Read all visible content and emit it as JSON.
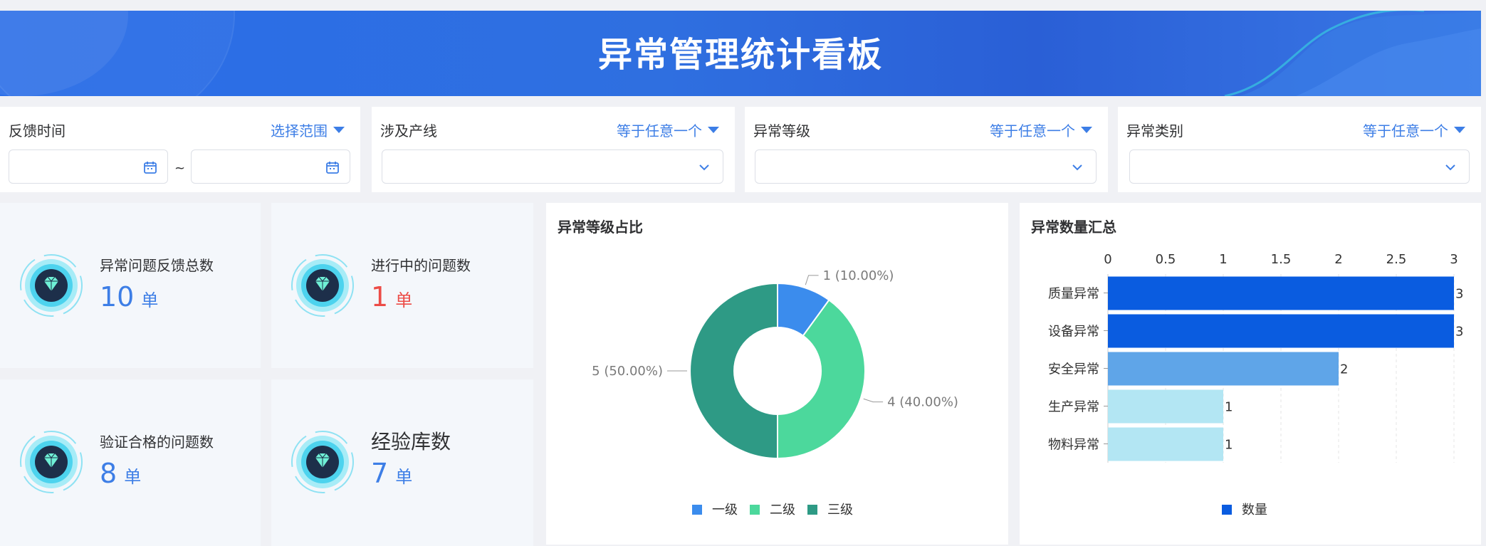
{
  "header": {
    "title": "异常管理统计看板"
  },
  "filters": [
    {
      "label": "反馈时间",
      "mode": "选择范围",
      "type": "date-range",
      "start_value": "",
      "end_value": "",
      "separator": "~"
    },
    {
      "label": "涉及产线",
      "mode": "等于任意一个",
      "type": "select",
      "value": ""
    },
    {
      "label": "异常等级",
      "mode": "等于任意一个",
      "type": "select",
      "value": ""
    },
    {
      "label": "异常类别",
      "mode": "等于任意一个",
      "type": "select",
      "value": ""
    }
  ],
  "stats": [
    {
      "label": "异常问题反馈总数",
      "value": "10",
      "unit": "单",
      "icon": "diamond-icon"
    },
    {
      "label": "进行中的问题数",
      "value": "1",
      "unit": "单",
      "icon": "diamond-icon",
      "value_color": "#ec4c47"
    },
    {
      "label": "验证合格的问题数",
      "value": "8",
      "unit": "单",
      "icon": "diamond-icon"
    },
    {
      "label": "经验库数",
      "value": "7",
      "unit": "单",
      "icon": "diamond-icon"
    }
  ],
  "colors": {
    "accent": "#3d7ee6",
    "red": "#ec4c47",
    "banner": "#2a6ee8"
  },
  "chart_data": [
    {
      "type": "pie",
      "title": "异常等级占比",
      "labels": [
        "一级",
        "二级",
        "三级"
      ],
      "values": [
        1,
        4,
        5
      ],
      "data_labels": [
        "1 (10.00%)",
        "4 (40.00%)",
        "5 (50.00%)"
      ],
      "colors": [
        "#3b8ced",
        "#4cd89c",
        "#2e9a85"
      ],
      "donut": true,
      "legend": "bottom"
    },
    {
      "type": "bar",
      "orientation": "horizontal",
      "title": "异常数量汇总",
      "categories": [
        "质量异常",
        "设备异常",
        "安全异常",
        "生产异常",
        "物料异常"
      ],
      "series": [
        {
          "name": "数量",
          "values": [
            3,
            3,
            2,
            1,
            1
          ]
        }
      ],
      "bar_colors": [
        "#0a5ce0",
        "#0a5ce0",
        "#5fa5e8",
        "#b3e6f3",
        "#b3e6f3"
      ],
      "legend_color": "#0a5ce0",
      "xticks": [
        "0",
        "0.5",
        "1",
        "1.5",
        "2",
        "2.5",
        "3"
      ],
      "xlim": [
        0,
        3
      ],
      "legend": "bottom",
      "grid": true
    }
  ]
}
